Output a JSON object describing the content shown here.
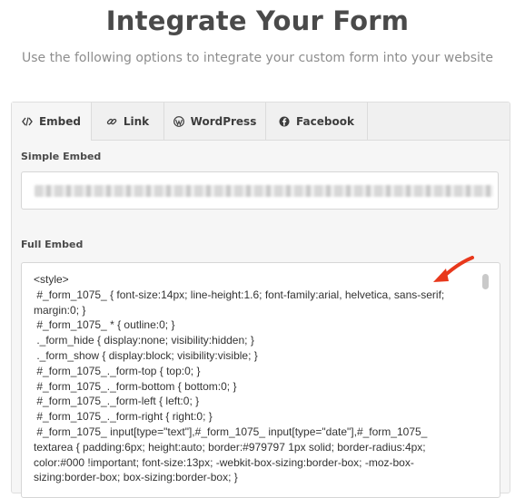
{
  "header": {
    "title": "Integrate Your Form",
    "subtitle": "Use the following options to integrate your custom form into your website"
  },
  "tabs": [
    {
      "label": "Embed",
      "icon": "code-icon",
      "active": true
    },
    {
      "label": "Link",
      "icon": "link-icon",
      "active": false
    },
    {
      "label": "WordPress",
      "icon": "wordpress-icon",
      "active": false
    },
    {
      "label": "Facebook",
      "icon": "facebook-icon",
      "active": false
    }
  ],
  "simple_embed": {
    "label": "Simple Embed"
  },
  "full_embed": {
    "label": "Full Embed",
    "code": "<style>\n #_form_1075_ { font-size:14px; line-height:1.6; font-family:arial, helvetica, sans-serif; margin:0; }\n #_form_1075_ * { outline:0; }\n ._form_hide { display:none; visibility:hidden; }\n ._form_show { display:block; visibility:visible; }\n #_form_1075_._form-top { top:0; }\n #_form_1075_._form-bottom { bottom:0; }\n #_form_1075_._form-left { left:0; }\n #_form_1075_._form-right { right:0; }\n #_form_1075_ input[type=\"text\"],#_form_1075_ input[type=\"date\"],#_form_1075_ textarea { padding:6px; height:auto; border:#979797 1px solid; border-radius:4px; color:#000 !important; font-size:13px; -webkit-box-sizing:border-box; -moz-box-sizing:border-box; box-sizing:border-box; }"
  },
  "colors": {
    "title": "#4a4a4a",
    "subtitle": "#8d8d8d",
    "annotation_arrow": "#e8381c"
  }
}
